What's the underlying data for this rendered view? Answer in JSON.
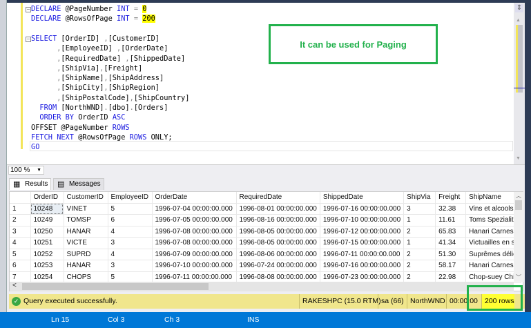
{
  "editor": {
    "lines": [
      {
        "parts": [
          [
            "kw",
            "DECLARE "
          ],
          [
            "",
            "@PageNumber "
          ],
          [
            "kw",
            "INT "
          ],
          [
            "gr",
            "= "
          ],
          [
            "hl",
            "0"
          ]
        ]
      },
      {
        "parts": [
          [
            "kw",
            "DECLARE "
          ],
          [
            "",
            "@RowsOfPage "
          ],
          [
            "kw",
            "INT "
          ],
          [
            "gr",
            "= "
          ],
          [
            "hl",
            "200"
          ]
        ]
      },
      {
        "parts": []
      },
      {
        "parts": [
          [
            "kw",
            "SELECT "
          ],
          [
            "",
            "[OrderID] "
          ],
          [
            "gr",
            ","
          ],
          [
            "",
            "[CustomerID]"
          ]
        ]
      },
      {
        "parts": [
          [
            "",
            "      "
          ],
          [
            "gr",
            ","
          ],
          [
            "",
            "[EmployeeID] "
          ],
          [
            "gr",
            ","
          ],
          [
            "",
            "[OrderDate]"
          ]
        ]
      },
      {
        "parts": [
          [
            "",
            "      "
          ],
          [
            "gr",
            ","
          ],
          [
            "",
            "[RequiredDate] "
          ],
          [
            "gr",
            ","
          ],
          [
            "",
            "[ShippedDate]"
          ]
        ]
      },
      {
        "parts": [
          [
            "",
            "      "
          ],
          [
            "gr",
            ","
          ],
          [
            "",
            "[ShipVia]"
          ],
          [
            "gr",
            ","
          ],
          [
            "",
            "[Freight]"
          ]
        ]
      },
      {
        "parts": [
          [
            "",
            "      "
          ],
          [
            "gr",
            ","
          ],
          [
            "",
            "[ShipName]"
          ],
          [
            "gr",
            ","
          ],
          [
            "",
            "[ShipAddress]"
          ]
        ]
      },
      {
        "parts": [
          [
            "",
            "      "
          ],
          [
            "gr",
            ","
          ],
          [
            "",
            "[ShipCity]"
          ],
          [
            "gr",
            ","
          ],
          [
            "",
            "[ShipRegion]"
          ]
        ]
      },
      {
        "parts": [
          [
            "",
            "      "
          ],
          [
            "gr",
            ","
          ],
          [
            "",
            "[ShipPostalCode]"
          ],
          [
            "gr",
            ","
          ],
          [
            "",
            "[ShipCountry]"
          ]
        ]
      },
      {
        "parts": [
          [
            "",
            "  "
          ],
          [
            "kw",
            "FROM "
          ],
          [
            "",
            "[NorthWND]"
          ],
          [
            "gr",
            "."
          ],
          [
            "",
            "[dbo]"
          ],
          [
            "gr",
            "."
          ],
          [
            "",
            "[Orders]"
          ]
        ]
      },
      {
        "parts": [
          [
            "",
            "  "
          ],
          [
            "kw",
            "ORDER BY "
          ],
          [
            "",
            "OrderID "
          ],
          [
            "kw",
            "ASC"
          ]
        ]
      },
      {
        "parts": [
          [
            "",
            "OFFSET @PageNumber "
          ],
          [
            "kw",
            "ROWS"
          ]
        ]
      },
      {
        "parts": [
          [
            "kw",
            "FETCH NEXT "
          ],
          [
            "",
            "@RowsOfPage "
          ],
          [
            "kw",
            "ROWS "
          ],
          [
            "",
            "ONLY;"
          ]
        ]
      },
      {
        "parts": [
          [
            "kw",
            "GO"
          ]
        ]
      }
    ]
  },
  "callout": "It can be used for Paging",
  "zoom": "100 %",
  "tabs": {
    "results": "Results",
    "messages": "Messages"
  },
  "grid": {
    "columns": [
      "",
      "OrderID",
      "CustomerID",
      "EmployeeID",
      "OrderDate",
      "RequiredDate",
      "ShippedDate",
      "ShipVia",
      "Freight",
      "ShipName"
    ],
    "rows": [
      [
        "1",
        "10248",
        "VINET",
        "5",
        "1996-07-04 00:00:00.000",
        "1996-08-01 00:00:00.000",
        "1996-07-16 00:00:00.000",
        "3",
        "32.38",
        "Vins et alcools"
      ],
      [
        "2",
        "10249",
        "TOMSP",
        "6",
        "1996-07-05 00:00:00.000",
        "1996-08-16 00:00:00.000",
        "1996-07-10 00:00:00.000",
        "1",
        "11.61",
        "Toms Spezialit"
      ],
      [
        "3",
        "10250",
        "HANAR",
        "4",
        "1996-07-08 00:00:00.000",
        "1996-08-05 00:00:00.000",
        "1996-07-12 00:00:00.000",
        "2",
        "65.83",
        "Hanari Carnes"
      ],
      [
        "4",
        "10251",
        "VICTE",
        "3",
        "1996-07-08 00:00:00.000",
        "1996-08-05 00:00:00.000",
        "1996-07-15 00:00:00.000",
        "1",
        "41.34",
        "Victuailles en s"
      ],
      [
        "5",
        "10252",
        "SUPRD",
        "4",
        "1996-07-09 00:00:00.000",
        "1996-08-06 00:00:00.000",
        "1996-07-11 00:00:00.000",
        "2",
        "51.30",
        "Suprêmes délic"
      ],
      [
        "6",
        "10253",
        "HANAR",
        "3",
        "1996-07-10 00:00:00.000",
        "1996-07-24 00:00:00.000",
        "1996-07-16 00:00:00.000",
        "2",
        "58.17",
        "Hanari Carnes"
      ],
      [
        "7",
        "10254",
        "CHOPS",
        "5",
        "1996-07-11 00:00:00.000",
        "1996-08-08 00:00:00.000",
        "1996-07-23 00:00:00.000",
        "2",
        "22.98",
        "Chop-suey Chi"
      ]
    ]
  },
  "status": {
    "message": "Query executed successfully.",
    "server": "RAKESHPC (15.0 RTM)",
    "user": "sa (66)",
    "database": "NorthWND",
    "time": "00:00:00",
    "rows": "200 rows"
  },
  "statusbar": {
    "ln": "Ln 15",
    "col": "Col 3",
    "ch": "Ch 3",
    "mode": "INS"
  }
}
